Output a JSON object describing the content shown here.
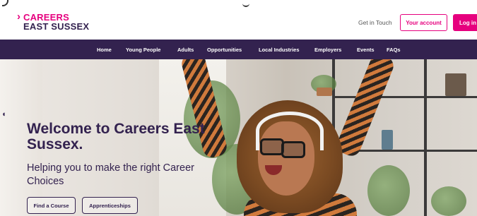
{
  "header": {
    "logo": {
      "line1": "CAREERS",
      "line2": "EAST SUSSEX",
      "chevron": "›"
    },
    "get_in_touch": "Get in Touch",
    "account_button": "Your account",
    "login_button": "Log in"
  },
  "nav": {
    "items": [
      "Home",
      "Young People",
      "Adults",
      "Opportunities",
      "Local Industries",
      "Employers",
      "Events",
      "FAQs"
    ]
  },
  "hero": {
    "title": "Welcome to Careers East Sussex.",
    "subtitle": "Helping you to make the right Career Choices",
    "buttons": [
      "Find a Course",
      "Apprenticeships"
    ],
    "prev_icon": "chevron-left-icon"
  },
  "colors": {
    "brand_pink": "#e6007e",
    "brand_purple": "#33224f"
  }
}
